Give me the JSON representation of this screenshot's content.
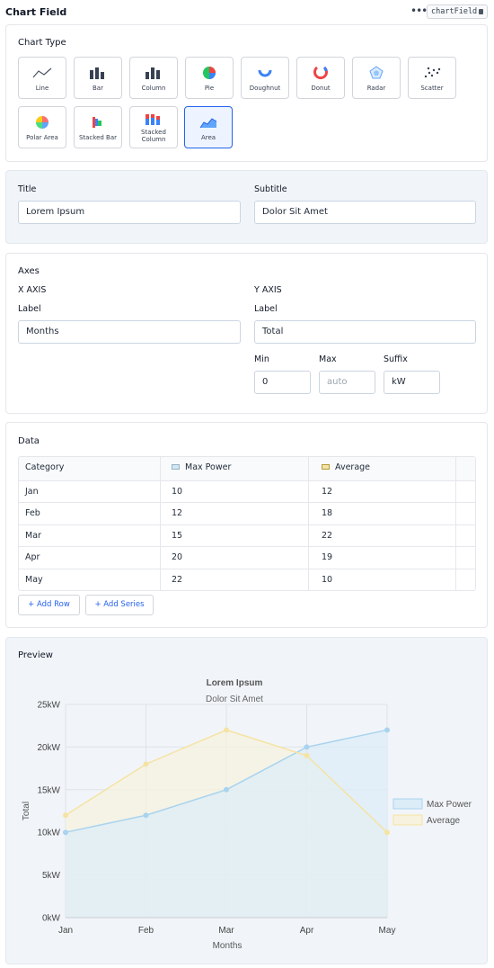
{
  "header": {
    "title": "Chart Field",
    "menu": "•••",
    "field_key": "chartField"
  },
  "chart_type": {
    "title": "Chart Type",
    "options": [
      {
        "label": "Line",
        "icon": "line-chart-icon"
      },
      {
        "label": "Bar",
        "icon": "bar-chart-icon"
      },
      {
        "label": "Column",
        "icon": "column-chart-icon"
      },
      {
        "label": "Pie",
        "icon": "pie-chart-icon"
      },
      {
        "label": "Doughnut",
        "icon": "doughnut-chart-icon"
      },
      {
        "label": "Donut",
        "icon": "donut-chart-icon"
      },
      {
        "label": "Radar",
        "icon": "radar-chart-icon"
      },
      {
        "label": "Scatter",
        "icon": "scatter-chart-icon"
      },
      {
        "label": "Polar Area",
        "icon": "polar-area-chart-icon"
      },
      {
        "label": "Stacked Bar",
        "icon": "stacked-bar-chart-icon"
      },
      {
        "label": "Stacked Column",
        "icon": "stacked-column-chart-icon"
      },
      {
        "label": "Area",
        "icon": "area-chart-icon"
      }
    ],
    "selected": "Area"
  },
  "titles": {
    "title_label": "Title",
    "title_value": "Lorem Ipsum",
    "subtitle_label": "Subtitle",
    "subtitle_value": "Dolor Sit Amet"
  },
  "axes": {
    "title": "Axes",
    "x": {
      "heading": "X AXIS",
      "label_label": "Label",
      "label_value": "Months"
    },
    "y": {
      "heading": "Y AXIS",
      "label_label": "Label",
      "label_value": "Total",
      "min_label": "Min",
      "min_value": "0",
      "max_label": "Max",
      "max_placeholder": "auto",
      "suffix_label": "Suffix",
      "suffix_value": "kW"
    }
  },
  "data_section": {
    "title": "Data",
    "columns": [
      "Category",
      "Max Power",
      "Average"
    ],
    "rows": [
      [
        "Jan",
        "10",
        "12"
      ],
      [
        "Feb",
        "12",
        "18"
      ],
      [
        "Mar",
        "15",
        "22"
      ],
      [
        "Apr",
        "20",
        "19"
      ],
      [
        "May",
        "22",
        "10"
      ]
    ],
    "add_row": "+ Add Row",
    "add_series": "+ Add Series"
  },
  "preview": {
    "title": "Preview"
  },
  "colors": {
    "accent": "#2563eb",
    "series1_line": "#a9d3ee",
    "series1_fill": "#dcedf8",
    "series2_line": "#f5e3a3",
    "series2_fill": "#f7f2de"
  },
  "chart_data": {
    "type": "area",
    "title": "Lorem Ipsum",
    "subtitle": "Dolor Sit Amet",
    "categories": [
      "Jan",
      "Feb",
      "Mar",
      "Apr",
      "May"
    ],
    "series": [
      {
        "name": "Max Power",
        "values": [
          10,
          12,
          15,
          20,
          22
        ]
      },
      {
        "name": "Average",
        "values": [
          12,
          18,
          22,
          19,
          10
        ]
      }
    ],
    "xlabel": "Months",
    "ylabel": "Total",
    "ylim": [
      0,
      25
    ],
    "yticks": [
      0,
      5,
      10,
      15,
      20,
      25
    ],
    "ytick_labels": [
      "0kW",
      "5kW",
      "10kW",
      "15kW",
      "20kW",
      "25kW"
    ],
    "legend": "right",
    "grid": true
  }
}
